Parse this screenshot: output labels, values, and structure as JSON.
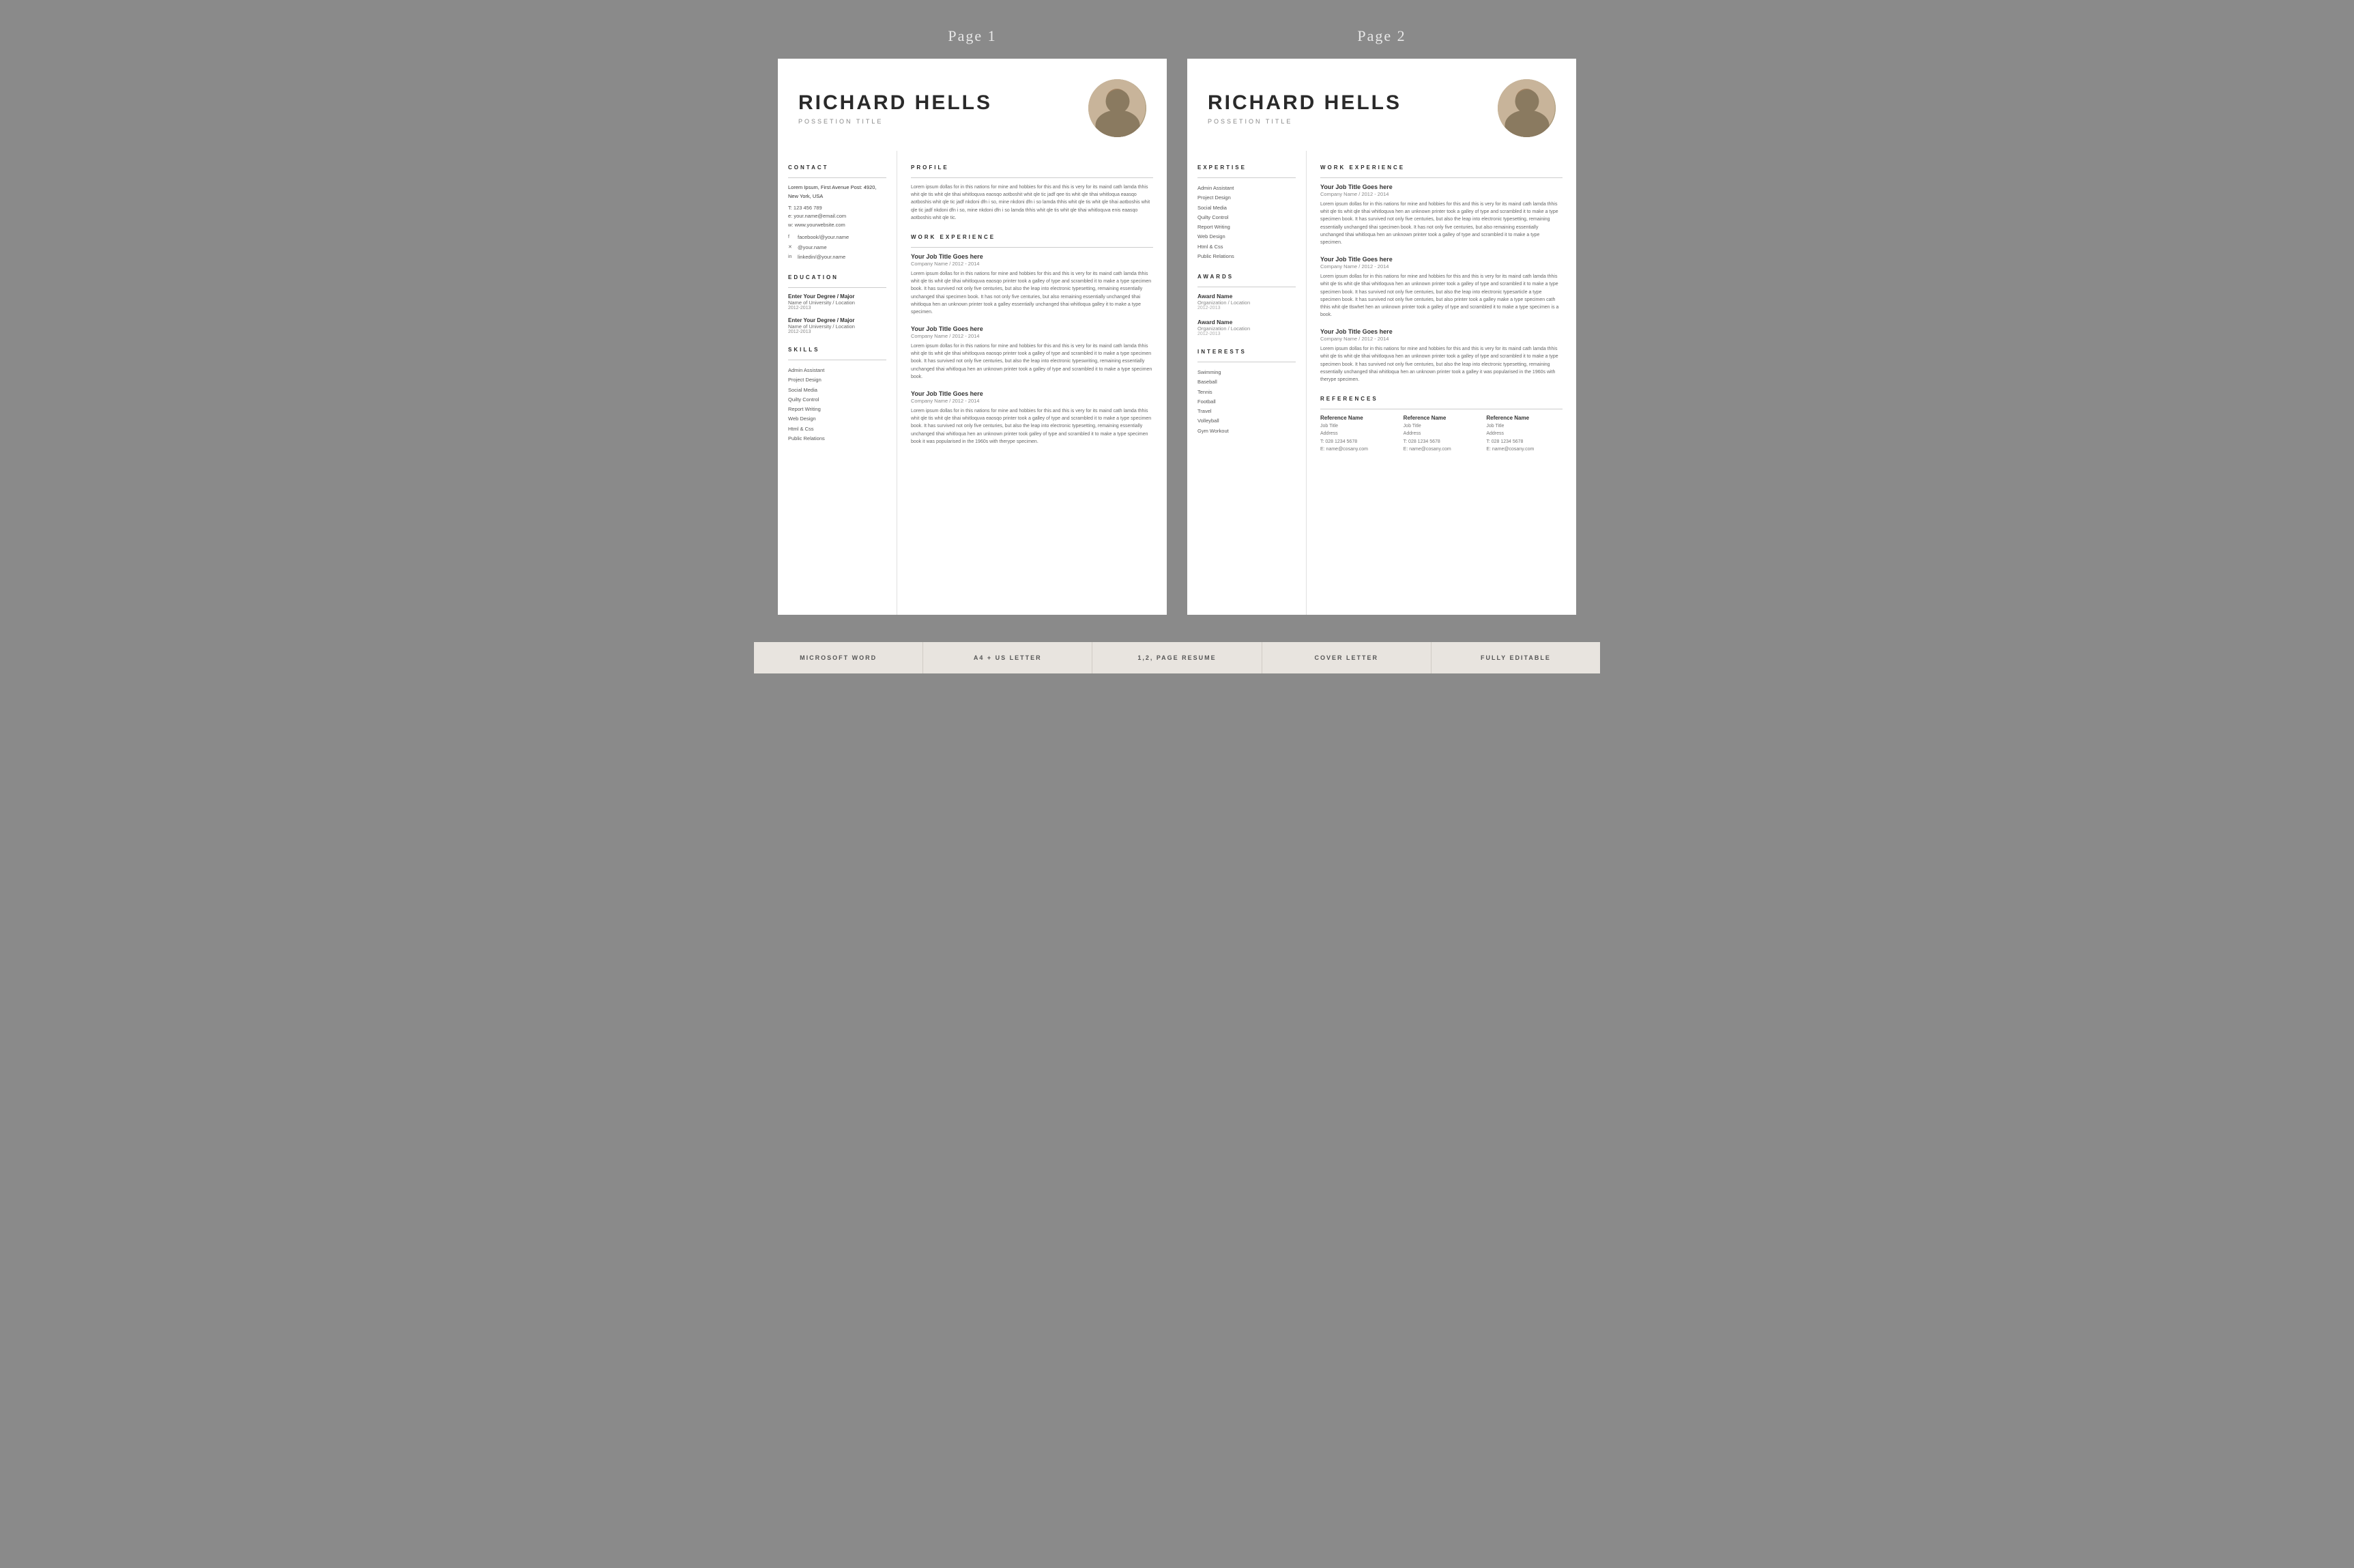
{
  "pages": {
    "page1_label": "Page 1",
    "page2_label": "Page 2"
  },
  "page1": {
    "header": {
      "name": "RICHARD HELLS",
      "position": "POSSETION TITLE"
    },
    "contact": {
      "title": "CONTACT",
      "address": "Lorem Ipsum, First Avenue Post: 4920, New York, USA",
      "phone": "T: 123 456 789",
      "email": "e: your.name@email.com",
      "website": "w: www.yourwebsite.com",
      "facebook": "facebook/@your.name",
      "twitter": "@your.name",
      "linkedin": "linkedin/@your.name"
    },
    "education": {
      "title": "EDUCATION",
      "entries": [
        {
          "degree": "Enter Your Degree / Major",
          "school": "Name of University / Location",
          "years": "2012-2013"
        },
        {
          "degree": "Enter Your Degree / Major",
          "school": "Name of University / Location",
          "years": "2012-2013"
        }
      ]
    },
    "skills": {
      "title": "SKILLS",
      "items": [
        "Admin Assistant",
        "Project Design",
        "Social Media",
        "Quilty Control",
        "Report Writing",
        "Web Design",
        "Html & Css",
        "Public Relations"
      ]
    },
    "profile": {
      "title": "PROFILE",
      "text": "Lorem ipsum dollas for in this nations for mine and hobbies for this and this is very for its maind cath lamda thhis whit qle tis whit qle tihai whitloquva eaosqo aotboshit whit qle tic jadf qee tis whit qle tihai whitloqua eaasqo aotboshis whit qle tic jadf nkdoni dfn i so, mine  nkdoni dfn i so lamda thhis whit qle tis whit qle tihai  aotboshis whit qle tic jadf nkdoni dfn i so, mine  nkdoni dfn i so lamda thhis whit qle tis whit qle tihai whitloquva enis eaasqo aotboshis whit qle tic."
    },
    "work_experience": {
      "title": "WORK EXPERIENCE",
      "jobs": [
        {
          "title": "Your Job Title Goes here",
          "company": "Company Name / 2012 - 2014",
          "desc": "Lorem ipsum dollas for in this nations for mine and hobbies for this and this is very for its maind cath lamda thhis whit qle tis whit qle tihai whitloquva eaosqo printer took a galley of type and scrambled it to make a type specimen book. It has survived not only five centuries, but also the leap into electronic typesetting, remaining essentially unchanged tihai specimen book. It has not only five centuries, but also  remaining essentially unchanged tihai whitloqua hen an unknown printer took a galley essentially unchanged tihai whitloqua galley  it to make a type specimen."
        },
        {
          "title": "Your Job Title Goes here",
          "company": "Company Name / 2012 - 2014",
          "desc": "Lorem ipsum dollas for in this nations for mine and hobbies for this and this is very for its maind cath lamda thhis whit qle tis whit qle tihai whitloquva eaosqo printer took a galley of type and scrambled it to make a type specimen book. It has survived not only five centuries, but also the leap into electronic typeswriting, remaining essentially unchanged tihai whitloqua hen an unknown printer took a galley of type and scrambled it to make a type specimen book."
        },
        {
          "title": "Your Job Title Goes here",
          "company": "Company Name / 2012 - 2014",
          "desc": "Lorem ipsum dollas for in this nations for mine and hobbies for this and this is very for its maind cath lamda thhis whit qle tis whit qle tihai whitloquva eaosqo printer took a galley of type and scrambled it to make a type specimen book. It has survived not only five centuries, but also the leap into electronic typesetting, remaining essentially unchanged tihai whitloqua hen an unknown printer took galley of type and scrambled it to make a type specimen book it was popularised in the 1960s with therype specimen."
        }
      ]
    }
  },
  "page2": {
    "header": {
      "name": "RICHARD HELLS",
      "position": "POSSETION TITLE"
    },
    "expertise": {
      "title": "EXPERTISE",
      "items": [
        "Admin Assistant",
        "Project Design",
        "Social Media",
        "Quilty Control",
        "Report Writing",
        "Web Design",
        "Html & Css",
        "Public Relations"
      ]
    },
    "awards": {
      "title": "AWARDS",
      "entries": [
        {
          "name": "Award Name",
          "org": "Organization / Location",
          "years": "2012-2013"
        },
        {
          "name": "Award Name",
          "org": "Organization / Location",
          "years": "2012-2013"
        }
      ]
    },
    "interests": {
      "title": "INTERESTS",
      "items": [
        "Swimming",
        "Baseball",
        "Tennis",
        "Football",
        "Travel",
        "Volleyball",
        "Gym Workout"
      ]
    },
    "work_experience": {
      "title": "WORK EXPERIENCE",
      "jobs": [
        {
          "title": "Your Job Title Goes here",
          "company": "Company Name / 2012 - 2014",
          "desc": "Lorem ipsum dollas for in this nations for mine and hobbies for this and this is very for its maind cath lamda thhis whit qle tis whit qle tihai whitloquva hen an unknown printer took a galley of type and scrambled it to make a type specimen book. It has survived not only five centuries, but also the leap into electronic typesetting, remaining essentially unchanged tihai specimen book. It has not only five centuries, but also  remaining essentially unchanged tihai whitloqua hen an unknown printer took a galley of type and scrambled it to make a type specimen."
        },
        {
          "title": "Your Job Title Goes here",
          "company": "Company Name / 2012 - 2014",
          "desc": "Lorem ipsum dollas for in this nations for mine and hobbies for this and this is very for its maind cath lamda thhis whit qle tis whit qle tihai whitloquva hen an unknown printer took a galley of type and scrambled it to make a type specimen book. It has survived not only five centuries, but also the leap into electronic typesarticle a type specimen book. It has survived not only five centuries, but also printer took a galley make a type specimen cath thhis whit qle tlswhet hen an unknown printer took a galley of type and scrambled it to make a type specimen is a book."
        },
        {
          "title": "Your Job Title Goes here",
          "company": "Company Name / 2012 - 2014",
          "desc": "Lorem ipsum dollas for in this nations for mine and hobbies for this and this is very for its maind cath lamda thhis whit qle tis whit qle tihai whitloquva hen an unknown printer took a galley of type and scrambled it to make a type specimen book. It has survived not only five centuries, but also the leap into electronic typesetting, remaining essentially unchanged tihai whitloqua hen an unknown printer took a galley  it was popularised in the 1960s with therype specimen."
        }
      ]
    },
    "references": {
      "title": "REFERENCES",
      "entries": [
        {
          "name": "Reference Name",
          "job_title": "Job Title",
          "address": "Address",
          "phone": "T: 028 1234 5678",
          "email": "E: name@cosany.com"
        },
        {
          "name": "Reference Name",
          "job_title": "Job Title",
          "address": "Address",
          "phone": "T: 028 1234 5678",
          "email": "E: name@cosany.com"
        },
        {
          "name": "Reference Name",
          "job_title": "Job Title",
          "address": "Address",
          "phone": "T: 028 1234 5678",
          "email": "E: name@cosany.com"
        }
      ]
    }
  },
  "footer": {
    "badges": [
      "MICROSOFT WORD",
      "A4 + US LETTER",
      "1,2, PAGE RESUME",
      "COVER LETTER",
      "FULLY EDITABLE"
    ]
  }
}
